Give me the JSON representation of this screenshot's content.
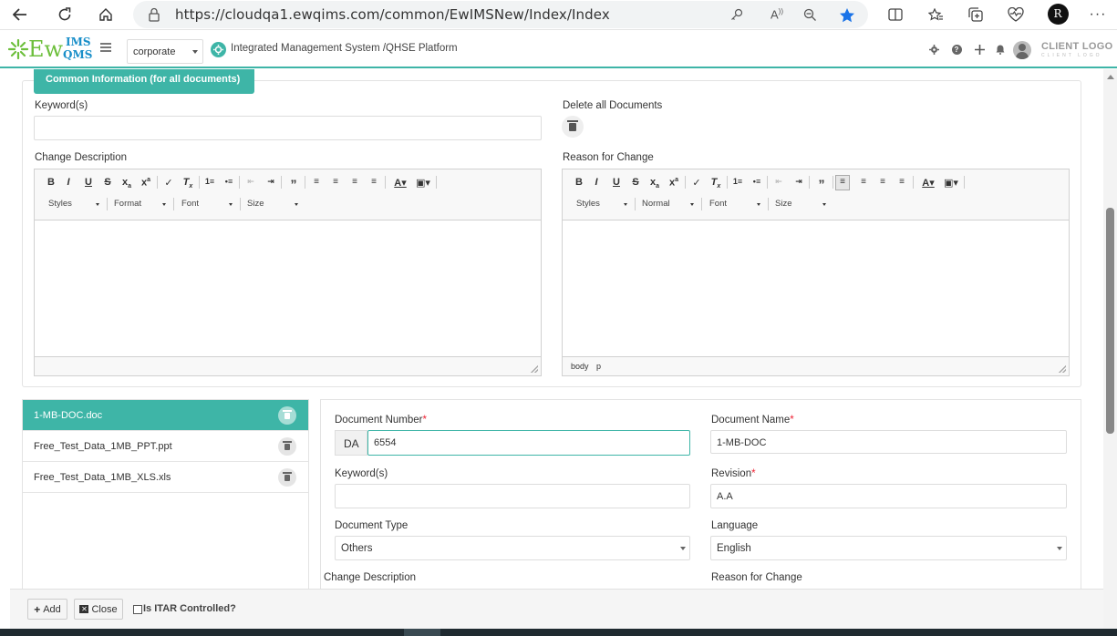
{
  "browser": {
    "url": "https://cloudqa1.ewqims.com/common/EwIMSNew/Index/Index",
    "profile_initial": "R"
  },
  "header": {
    "logo_main": "Ew",
    "logo_top": "IMS",
    "logo_bottom": "QMS",
    "org_value": "corporate",
    "platform_title": "Integrated Management System /QHSE Platform",
    "client_logo": "CLIENT LOGO",
    "client_logo_sub": "CLIENT LOGO"
  },
  "common": {
    "tab_label": "Common Information (for all documents)",
    "keywords_label": "Keyword(s)",
    "keywords_value": "",
    "delete_all_label": "Delete all Documents",
    "change_desc_label": "Change Description",
    "reason_label": "Reason for Change",
    "editor_left": {
      "styles": "Styles",
      "format": "Format",
      "font": "Font",
      "size": "Size"
    },
    "editor_right": {
      "styles": "Styles",
      "format": "Normal",
      "font": "Font",
      "size": "Size",
      "path_body": "body",
      "path_p": "p"
    }
  },
  "files": [
    {
      "name": "1-MB-DOC.doc",
      "active": true
    },
    {
      "name": "Free_Test_Data_1MB_PPT.ppt",
      "active": false
    },
    {
      "name": "Free_Test_Data_1MB_XLS.xls",
      "active": false
    }
  ],
  "document": {
    "number_label": "Document Number",
    "number_prefix": "DA",
    "number_value": "6554",
    "name_label": "Document Name",
    "name_value": "1-MB-DOC",
    "keywords_label": "Keyword(s)",
    "keywords_value": "",
    "revision_label": "Revision",
    "revision_value": "A.A",
    "type_label": "Document Type",
    "type_value": "Others",
    "language_label": "Language",
    "language_value": "English",
    "change_desc_label": "Change Description",
    "reason_label": "Reason for Change",
    "required_mark": "*"
  },
  "footer": {
    "add_label": "Add",
    "close_label": "Close",
    "itar_label": "Is ITAR Controlled?"
  },
  "colors": {
    "accent": "#3eb5a7",
    "required": "#e22233"
  }
}
